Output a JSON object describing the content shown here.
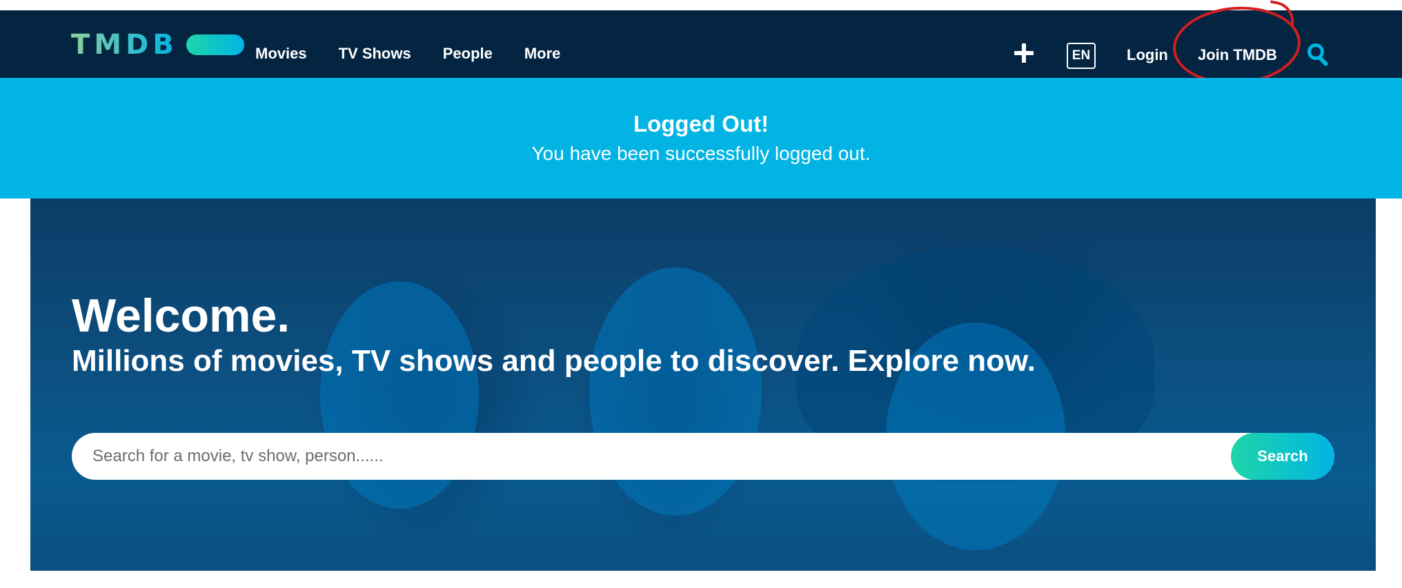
{
  "header": {
    "logo_text": "TMDB",
    "nav": [
      "Movies",
      "TV Shows",
      "People",
      "More"
    ],
    "plus_icon": "plus-icon",
    "language": "EN",
    "login_label": "Login",
    "join_label": "Join TMDB",
    "search_icon": "search-icon"
  },
  "notice": {
    "title": "Logged Out!",
    "message": "You have been successfully logged out."
  },
  "hero": {
    "title": "Welcome.",
    "subtitle": "Millions of movies, TV shows and people to discover. Explore now.",
    "search_placeholder": "Search for a movie, tv show, person......",
    "search_button": "Search"
  },
  "colors": {
    "header_bg": "#032541",
    "banner_bg": "#01b4e4",
    "accent_green": "#1ed5a9",
    "annotation_red": "#d11f1f"
  }
}
